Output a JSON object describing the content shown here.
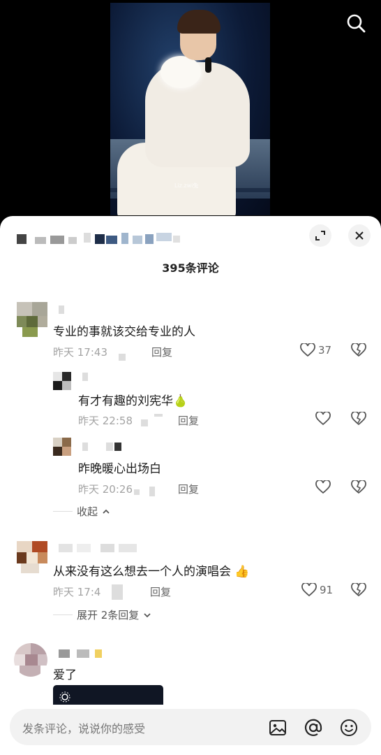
{
  "video": {
    "watermark": "Liz.zwi兔"
  },
  "header": {
    "comment_count": "395条评论"
  },
  "comments": [
    {
      "text": "专业的事就该交给专业的人",
      "time": "昨天 17:43",
      "reply_label": "回复",
      "likes": "37"
    },
    {
      "text": "有才有趣的刘宪华🍐",
      "time": "昨天 22:58",
      "reply_label": "回复",
      "likes": ""
    },
    {
      "text": "昨晚暖心出场白",
      "time": "昨天 20:26",
      "reply_label": "回复",
      "likes": ""
    },
    {
      "text": "从来没有这么想去一个人的演唱会 👍",
      "time": "昨天 17:4",
      "reply_label": "回复",
      "likes": "91"
    },
    {
      "text": "爱了"
    }
  ],
  "collapse_label": "收起",
  "expand_label": "展开 2条回复",
  "input": {
    "placeholder": "发条评论，说说你的感受"
  },
  "icons": [
    "search-icon",
    "expand-icon",
    "close-icon",
    "heart-icon",
    "broken-heart-icon",
    "chevron-up-icon",
    "chevron-down-icon",
    "image-icon",
    "at-icon",
    "emoji-icon"
  ],
  "colors": {
    "sheet_bg": "#ffffff",
    "input_bg": "#f2f2f2",
    "muted_text": "#a3a3a3"
  }
}
